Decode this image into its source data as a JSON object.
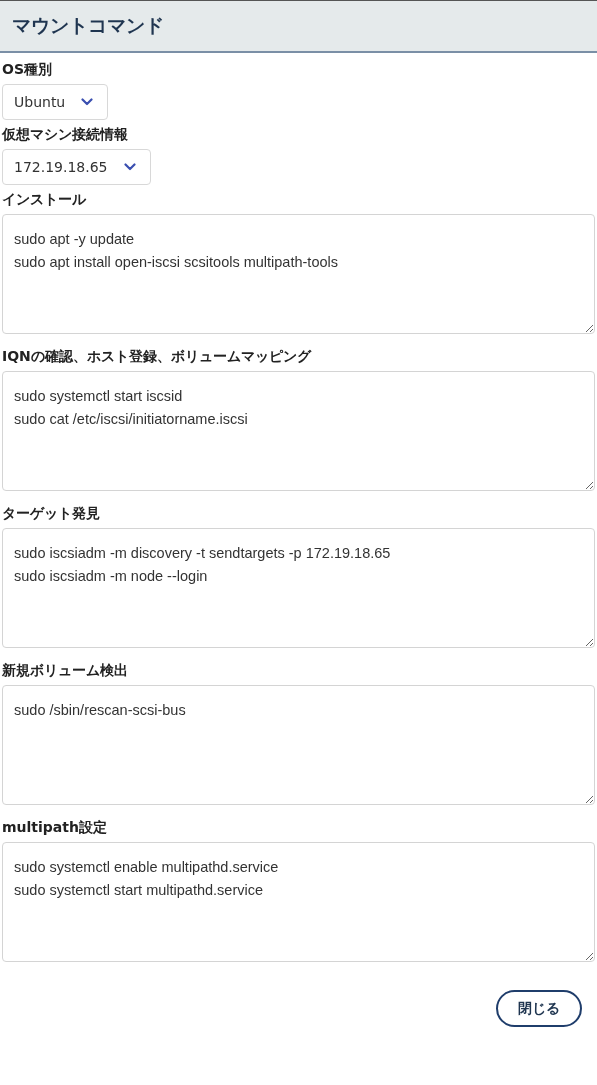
{
  "header": {
    "title": "マウントコマンド"
  },
  "selects": [
    {
      "label": "OS種別",
      "value": "Ubuntu"
    },
    {
      "label": "仮想マシン接続情報",
      "value": "172.19.18.65"
    }
  ],
  "sections": [
    {
      "label": "インストール",
      "lines": [
        "sudo apt -y update",
        "sudo apt install open-iscsi scsitools multipath-tools"
      ]
    },
    {
      "label": "IQNの確認、ホスト登録、ボリュームマッピング",
      "lines": [
        "sudo systemctl start iscsid",
        "sudo cat /etc/iscsi/initiatorname.iscsi"
      ]
    },
    {
      "label": "ターゲット発見",
      "lines": [
        "sudo iscsiadm -m discovery -t sendtargets -p 172.19.18.65",
        "sudo iscsiadm -m node --login"
      ]
    },
    {
      "label": "新規ボリューム検出",
      "lines": [
        "sudo /sbin/rescan-scsi-bus"
      ]
    },
    {
      "label": "multipath設定",
      "lines": [
        "sudo systemctl enable multipathd.service",
        "sudo systemctl start multipathd.service"
      ]
    }
  ],
  "close_button": "閉じる"
}
